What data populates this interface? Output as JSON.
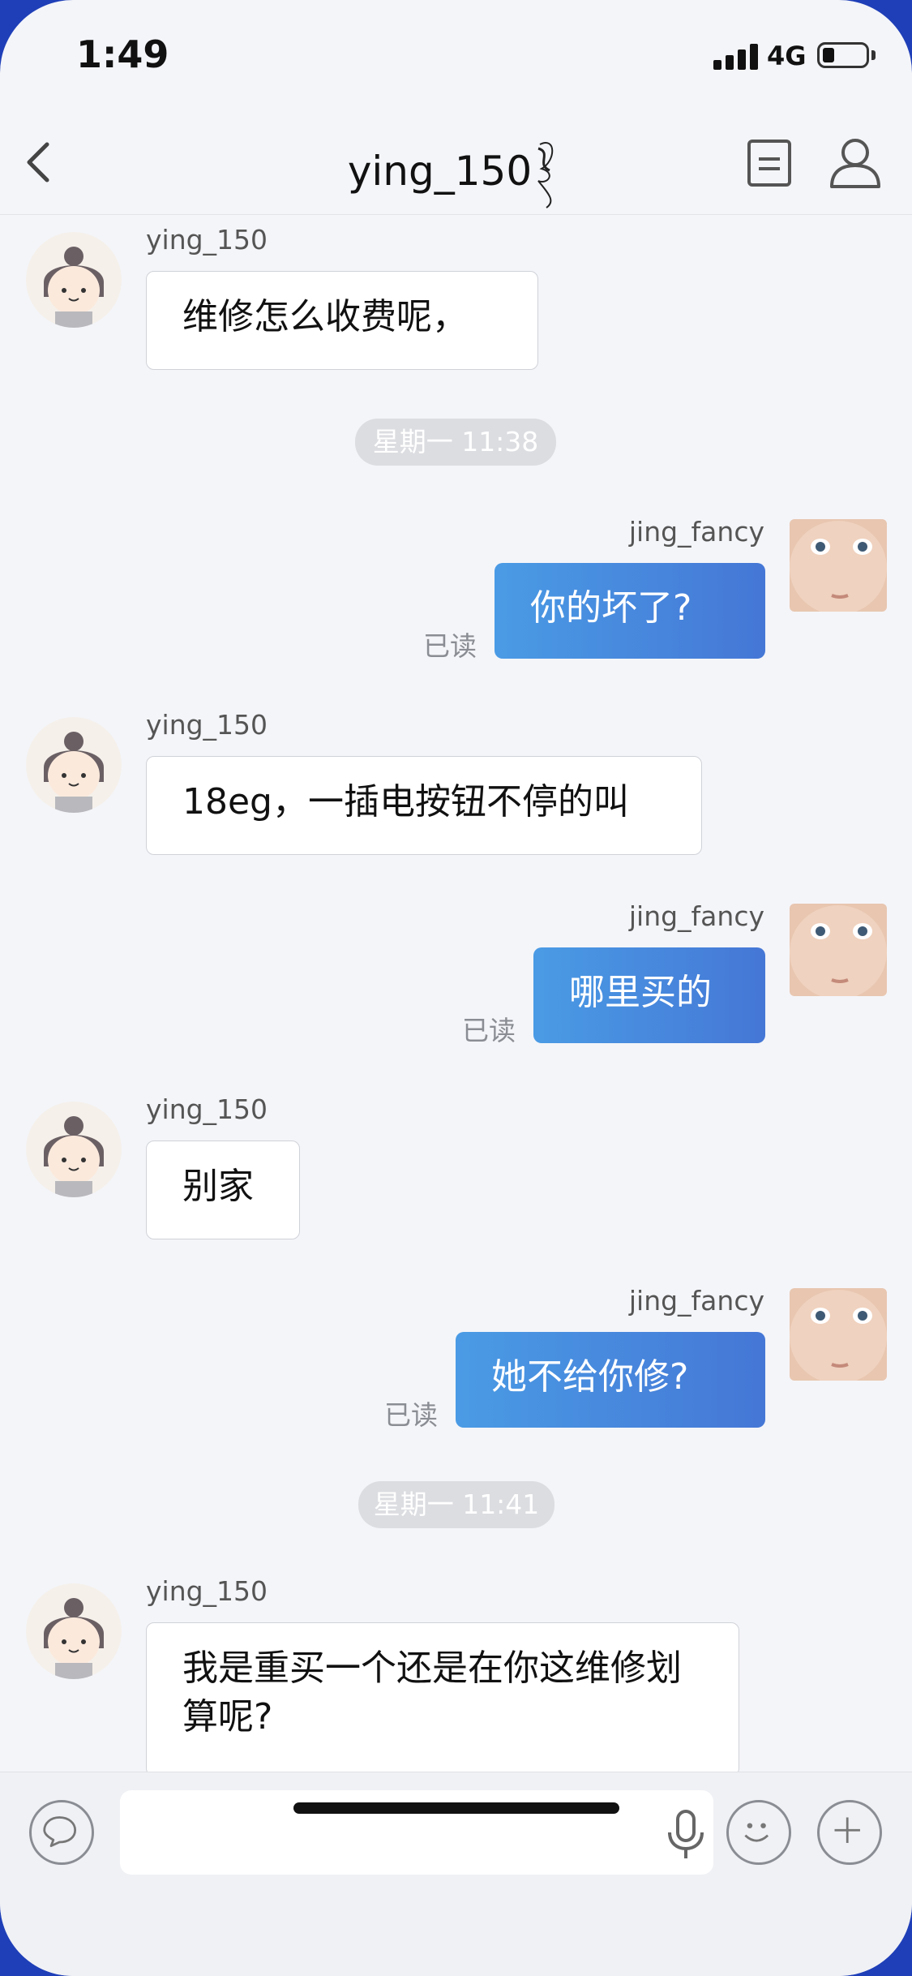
{
  "status": {
    "time": "1:49",
    "network": "4G"
  },
  "header": {
    "title": "ying_150"
  },
  "messages": [
    {
      "sender": "ying_150",
      "text": "维修怎么收费呢，"
    },
    {
      "timestamp": "星期一 11:38"
    },
    {
      "sender": "jing_fancy",
      "text": "你的坏了?",
      "read": "已读"
    },
    {
      "sender": "ying_150",
      "text": "18eg，一插电按钮不停的叫"
    },
    {
      "sender": "jing_fancy",
      "text": "哪里买的",
      "read": "已读"
    },
    {
      "sender": "ying_150",
      "text": "别家"
    },
    {
      "sender": "jing_fancy",
      "text": "她不给你修?",
      "read": "已读"
    },
    {
      "timestamp": "星期一 11:41"
    },
    {
      "sender": "ying_150",
      "text": "我是重买一个还是在你这维修划算呢?"
    }
  ],
  "input": {
    "value": ""
  },
  "icons": {
    "back": "chevron-left-icon",
    "doc": "document-icon",
    "profile": "person-icon",
    "chat": "speech-bubble-icon",
    "mic": "microphone-icon",
    "emoji": "smiley-icon",
    "add": "plus-icon"
  },
  "colors": {
    "outgoing_bubble": "#4a8fe0",
    "background": "#f4f5f9"
  }
}
